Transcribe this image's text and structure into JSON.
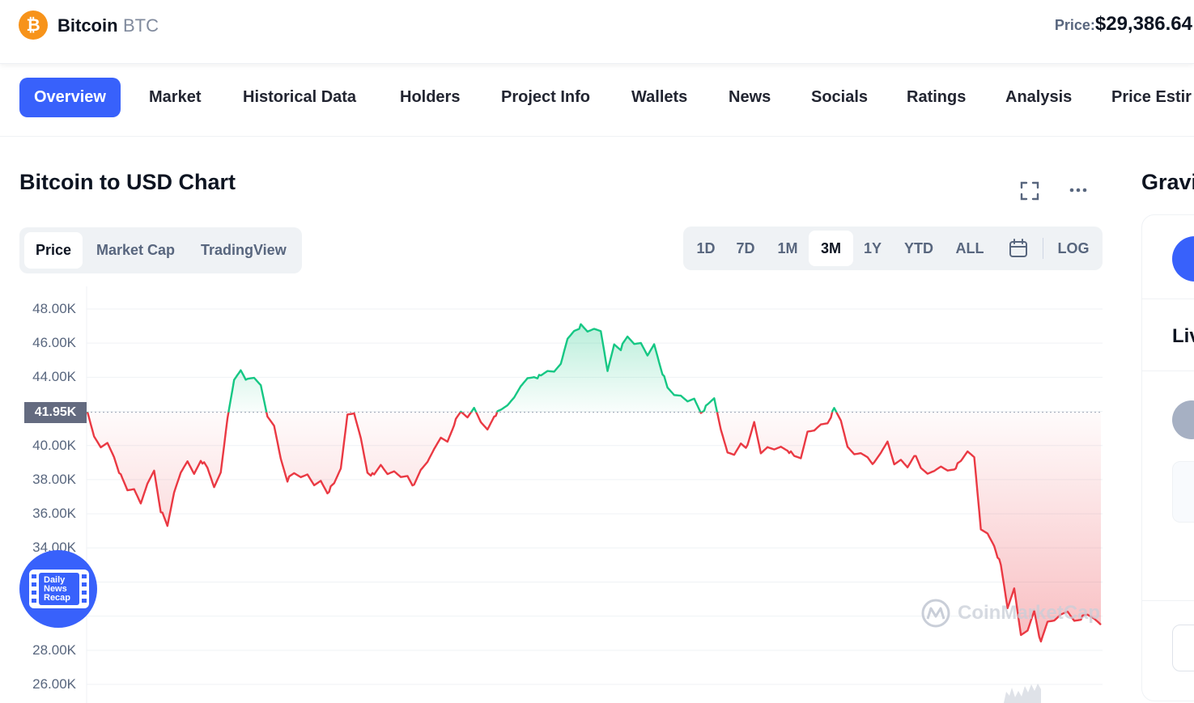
{
  "header": {
    "coin_name": "Bitcoin",
    "coin_symbol": "BTC",
    "price_label": "Price:",
    "price_value": "$29,386.64"
  },
  "nav": {
    "items": [
      {
        "label": "Overview",
        "active": true
      },
      {
        "label": "Market"
      },
      {
        "label": "Historical Data"
      },
      {
        "label": "Holders"
      },
      {
        "label": "Project Info"
      },
      {
        "label": "Wallets"
      },
      {
        "label": "News"
      },
      {
        "label": "Socials"
      },
      {
        "label": "Ratings"
      },
      {
        "label": "Analysis"
      },
      {
        "label": "Price Estir"
      }
    ]
  },
  "chart_section": {
    "title": "Bitcoin to USD Chart",
    "side_title": "Gravi",
    "tabs": [
      "Price",
      "Market Cap",
      "TradingView"
    ],
    "active_tab": "Price",
    "ranges": [
      "1D",
      "7D",
      "1M",
      "3M",
      "1Y",
      "YTD",
      "ALL"
    ],
    "active_range": "3M",
    "log_label": "LOG",
    "current_price_tag": "41.95K",
    "watermark": "CoinMarketCap",
    "news_badge": [
      "Daily",
      "News",
      "Recap"
    ],
    "side_label": "Liv"
  },
  "colors": {
    "accent": "#3861fb",
    "up": "#16c784",
    "down": "#ea3943"
  },
  "chart_data": {
    "type": "line",
    "y_tick_labels": [
      "48.00K",
      "46.00K",
      "44.00K",
      "40.00K",
      "38.00K",
      "36.00K",
      "34.00K",
      "28.00K",
      "26.00K"
    ],
    "ylim": [
      26000,
      48000
    ],
    "baseline": 41950,
    "grid": true,
    "values": [
      41900,
      40500,
      39900,
      40200,
      39400,
      38200,
      37300,
      37400,
      36600,
      37800,
      38600,
      36200,
      35200,
      37200,
      38400,
      39100,
      38400,
      39200,
      38600,
      37500,
      38400,
      41600,
      43900,
      44500,
      43800,
      43900,
      43500,
      41700,
      41200,
      39300,
      38000,
      38300,
      38100,
      38300,
      37700,
      38000,
      37300,
      37700,
      38600,
      41800,
      41900,
      40500,
      38500,
      38200,
      38800,
      38300,
      38500,
      38200,
      38300,
      37600,
      38500,
      39000,
      39800,
      40500,
      40300,
      41300,
      41900,
      41600,
      42200,
      41400,
      41000,
      41800,
      42000,
      42300,
      42800,
      43500,
      44000,
      44100,
      44000,
      44300,
      44300,
      44800,
      46300,
      46800,
      47000,
      46600,
      46800,
      46700,
      44400,
      46000,
      45700,
      46300,
      45900,
      46000,
      45300,
      46000,
      44600,
      43300,
      42900,
      42900,
      42600,
      42800,
      42000,
      42300,
      42700,
      40900,
      39600,
      39500,
      40200,
      39900,
      41300,
      39500,
      39900,
      39800,
      40000,
      39800,
      39300,
      39200,
      40800,
      40900,
      41300,
      41400,
      42100,
      41400,
      39900,
      39500,
      39600,
      39400,
      38900,
      39500,
      40200,
      38900,
      39200,
      38800,
      39500,
      38600,
      38300,
      38500,
      38800,
      38600,
      38700,
      39000,
      39600,
      39300,
      35100,
      34900,
      34200,
      32900,
      30400,
      31600,
      28900,
      29200,
      30400,
      28400,
      29600,
      29700,
      30100,
      30300,
      29800,
      29900,
      30000,
      29800,
      29500
    ]
  }
}
